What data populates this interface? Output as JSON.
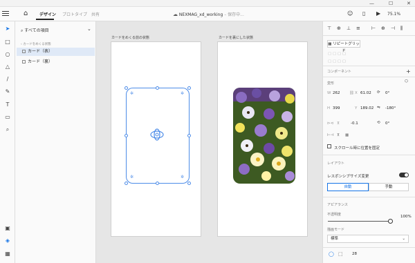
{
  "titlebar": {
    "min": "—",
    "max": "☐",
    "close": "✕"
  },
  "topbar": {
    "tabs": [
      "デザイン",
      "プロトタイプ",
      "共有"
    ],
    "doc_title": "NEXMAG_xd_working",
    "doc_sep": " – ",
    "doc_status": "保存中...",
    "zoom": "75.1%"
  },
  "layers": {
    "search": "すべての項目",
    "group": "カードをめくる状態",
    "items": [
      "カード（表）",
      "カード（裏）"
    ]
  },
  "canvas": {
    "artboard1": "カードをめくる前の状態",
    "artboard2": "カードを裏にした状態"
  },
  "props": {
    "repeat_grid": "リピートグリッド",
    "component": "コンポーネント",
    "transform": "変形",
    "w_label": "W",
    "w": "262",
    "x_label": "X",
    "x": "61.02",
    "rot": "0°",
    "h_label": "H",
    "h": "399",
    "y_label": "Y",
    "y": "189.02",
    "rot2": "-180°",
    "skew": "-0.1",
    "rot3": "0°",
    "fix_scroll": "スクロール時に位置を固定",
    "layout": "レイアウト",
    "responsive": "レスポンシブサイズ変更",
    "auto": "自動",
    "manual": "手動",
    "appearance": "アピアランス",
    "opacity_label": "不透明度",
    "opacity": "100%",
    "blend_label": "描画モード",
    "blend": "標準",
    "radius": "28"
  },
  "colors": {
    "accent": "#1473e6",
    "selection": "#4b8be8"
  }
}
